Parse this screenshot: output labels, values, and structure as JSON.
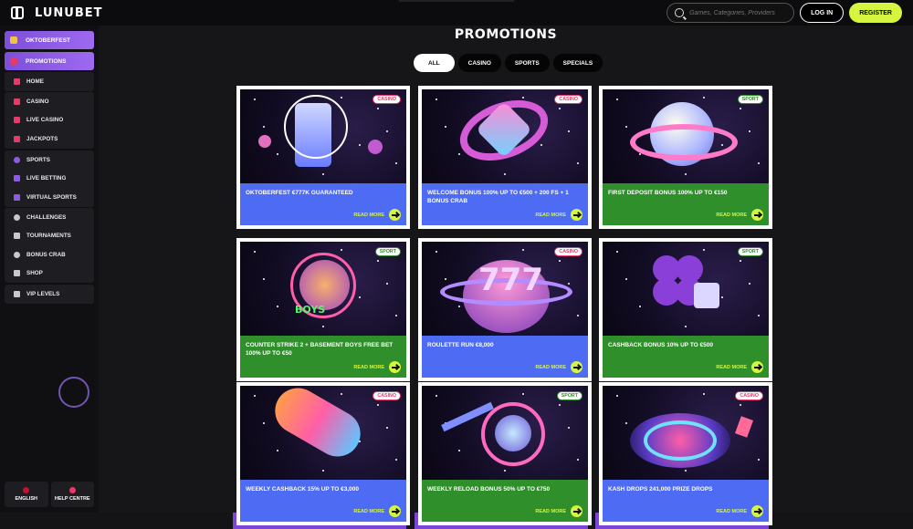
{
  "header": {
    "logo": "LUNUBET",
    "search_placeholder": "Games, Categories, Providers",
    "login_label": "LOG IN",
    "register_label": "REGISTER"
  },
  "sidebar": {
    "promo_items": [
      {
        "label": "OKTOBERFEST"
      },
      {
        "label": "PROMOTIONS"
      }
    ],
    "groups": [
      [
        {
          "label": "HOME"
        }
      ],
      [
        {
          "label": "CASINO"
        },
        {
          "label": "LIVE CASINO"
        },
        {
          "label": "JACKPOTS"
        }
      ],
      [
        {
          "label": "SPORTS"
        },
        {
          "label": "LIVE BETTING"
        },
        {
          "label": "VIRTUAL SPORTS"
        }
      ],
      [
        {
          "label": "CHALLENGES"
        },
        {
          "label": "TOURNAMENTS"
        },
        {
          "label": "BONUS CRAB"
        },
        {
          "label": "SHOP"
        }
      ],
      [
        {
          "label": "VIP LEVELS"
        }
      ]
    ],
    "bottom": {
      "language": "ENGLISH",
      "help": "HELP CENTRE"
    }
  },
  "main": {
    "title": "PROMOTIONS",
    "filters": [
      "ALL",
      "CASINO",
      "SPORTS",
      "SPECIALS"
    ],
    "active_filter": "ALL",
    "read_more_label": "READ MORE",
    "promotions": [
      {
        "name": "OKTOBERFEST €777K GUARANTEED",
        "tag": "CASINO",
        "color": "blue"
      },
      {
        "name": "WELCOME BONUS 100% UP TO €500 + 200 FS + 1 BONUS CRAB",
        "tag": "CASINO",
        "color": "blue"
      },
      {
        "name": "FIRST DEPOSIT BONUS 100% UP TO €150",
        "tag": "SPORT",
        "color": "green"
      },
      {
        "name": "COUNTER STRIKE 2 + BASEMENT BOYS FREE BET 100% UP TO €50",
        "tag": "SPORT",
        "color": "green"
      },
      {
        "name": "ROULETTE RUN €8,000",
        "tag": "CASINO",
        "color": "blue"
      },
      {
        "name": "CASHBACK BONUS 10% UP TO €500",
        "tag": "SPORT",
        "color": "green"
      },
      {
        "name": "WEEKLY CASHBACK 15% UP TO €3,000",
        "tag": "CASINO",
        "color": "blue"
      },
      {
        "name": "WEEKLY RELOAD BONUS 50% UP TO €750",
        "tag": "SPORT",
        "color": "green"
      },
      {
        "name": "KASH DROPS 241,000 PRIZE DROPS",
        "tag": "CASINO",
        "color": "blue"
      }
    ]
  },
  "colors": {
    "accent": "#d5f541",
    "promo_purple": "#8d5ae8",
    "casino_pink": "#e8396b",
    "sport_green": "#2f8f2a",
    "card_blue": "#4e6bf3"
  }
}
